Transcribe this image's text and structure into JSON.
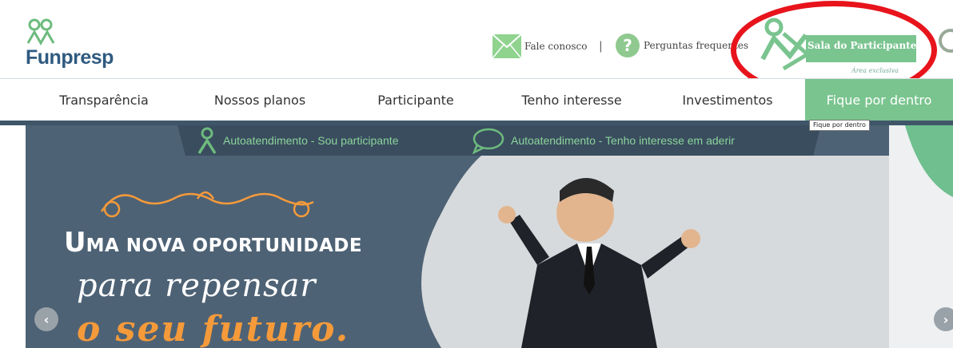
{
  "logo": {
    "name": "Funpresp",
    "icon": "people-logo-icon"
  },
  "header": {
    "contact_label": "Fale conosco",
    "separator": "|",
    "faq_label": "Perguntas frequentes",
    "sala_label": "Sala do Participante",
    "sala_sub": "Área exclusiva"
  },
  "nav": {
    "items": [
      {
        "label": "Transparência"
      },
      {
        "label": "Nossos planos"
      },
      {
        "label": "Participante"
      },
      {
        "label": "Tenho interesse"
      },
      {
        "label": "Investimentos"
      },
      {
        "label": "Fique por dentro",
        "active": true
      }
    ],
    "tooltip": "Fique por dentro"
  },
  "banner": {
    "auto_participante": "Autoatendimento - Sou participante",
    "auto_interesse": "Autoatendimento - Tenho interesse em aderir",
    "headline_cap": "U",
    "headline_rest": "MA NOVA OPORTUNIDADE",
    "headline_2": "para repensar",
    "headline_3": "o seu futuro."
  },
  "colors": {
    "brand_blue": "#2f5a80",
    "brand_green": "#7ac48f",
    "banner_bg": "#4e6275",
    "accent_orange": "#f59a3a",
    "highlight_red": "#e8141c"
  }
}
